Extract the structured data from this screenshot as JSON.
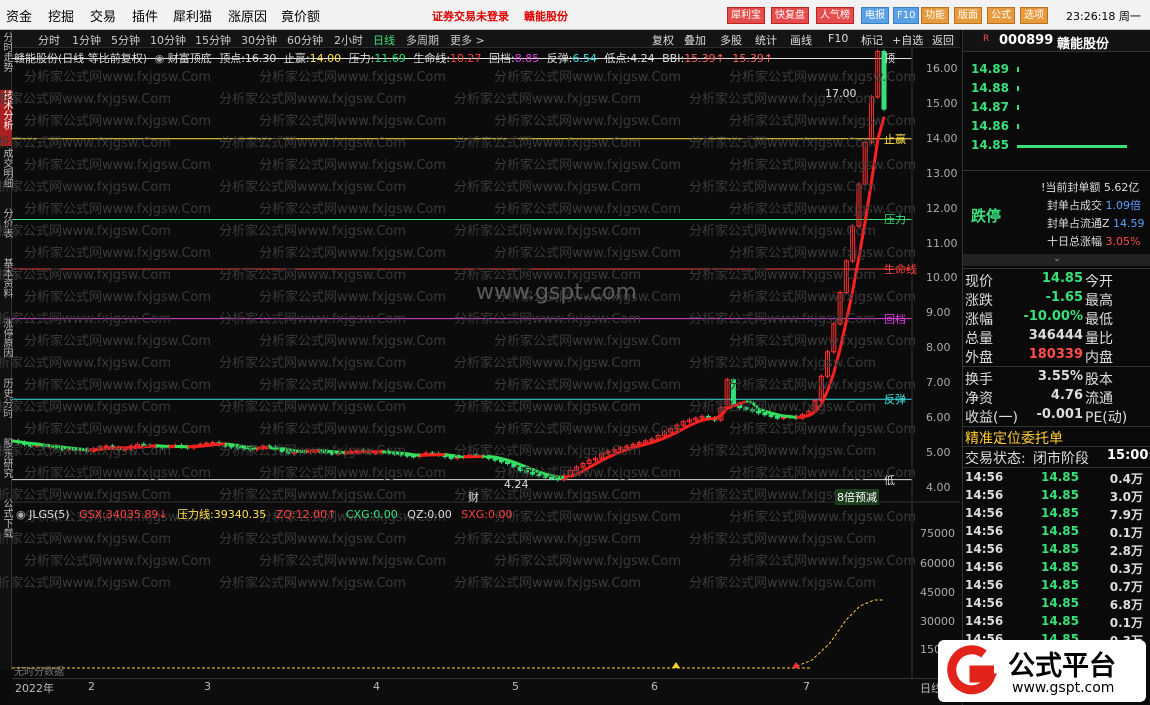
{
  "menu": [
    "资金",
    "挖掘",
    "交易",
    "插件",
    "犀利猫",
    "涨原因",
    "竟价额"
  ],
  "warning": "证券交易未登录",
  "warning_stock": "赣能股份",
  "top_buttons": [
    "犀利宝",
    "快复盘",
    "人气榜",
    "电报",
    "F10",
    "功能",
    "版面",
    "公式",
    "选项"
  ],
  "clock": "23:26:18 周一",
  "left_tabs": [
    "分时走势",
    "技术分析",
    "成交明细",
    "分价表",
    "基本资料",
    "涨停原因",
    "历史分时",
    "股东研究",
    "公式下载"
  ],
  "period_tabs": [
    "分时",
    "1分钟",
    "5分钟",
    "10分钟",
    "15分钟",
    "30分钟",
    "60分钟",
    "2小时",
    "日线",
    "多周期",
    "更多 >"
  ],
  "period_selected": "日线",
  "right_tools": [
    "复权",
    "叠加",
    "多股",
    "统计",
    "画线",
    "F10",
    "标记",
    "+自选",
    "返回"
  ],
  "indicator_header": {
    "stock": "赣能股份(日线 等比前复权)",
    "name": "财富顶底",
    "items": [
      {
        "label": "顶点:",
        "value": "16.30",
        "color": "#dddddd"
      },
      {
        "label": "止赢:",
        "value": "14.00",
        "color": "#ffe14a"
      },
      {
        "label": "压力:",
        "value": "11.69",
        "color": "#39e07a"
      },
      {
        "label": "生命线:",
        "value": "10.27",
        "color": "#ff4040"
      },
      {
        "label": "回档:",
        "value": "8.85",
        "color": "#e040e0"
      },
      {
        "label": "反弹:",
        "value": "6.54",
        "color": "#38e0e0"
      },
      {
        "label": "低点:",
        "value": "4.24",
        "color": "#dddddd"
      },
      {
        "label": "BBI:",
        "value": "15.39↑",
        "color": "#ff6060"
      },
      {
        "label": "",
        "value": "15.39↑",
        "color": "#ff6060"
      }
    ]
  },
  "levels": [
    {
      "name": "顶",
      "value": 16.3,
      "color": "#dddddd"
    },
    {
      "name": "止赢",
      "value": 14.0,
      "color": "#ffe14a"
    },
    {
      "name": "压力",
      "value": 11.69,
      "color": "#39e07a"
    },
    {
      "name": "生命线",
      "value": 10.27,
      "color": "#ff4040"
    },
    {
      "name": "回档",
      "value": 8.85,
      "color": "#e040e0"
    },
    {
      "name": "反弹",
      "value": 6.54,
      "color": "#38e0e0"
    },
    {
      "name": "低",
      "value": 4.24,
      "color": "#dddddd"
    }
  ],
  "price_axis": [
    "16.00",
    "15.00",
    "14.00",
    "13.00",
    "12.00",
    "11.00",
    "10.00",
    "9.00",
    "8.00",
    "7.00",
    "6.00",
    "5.00",
    "4.00"
  ],
  "peak_label": "17.00",
  "low_label": "4.24",
  "cai_marker": "财",
  "badge": "8倍预减",
  "indicator2": {
    "name": "JLGS(5)",
    "items": [
      {
        "label": "GSX:",
        "value": "34035.89↓",
        "color": "#ff4040"
      },
      {
        "label": "压力线:",
        "value": "39340.35",
        "color": "#ffe14a"
      },
      {
        "label": "ZQ:",
        "value": "12.00↑",
        "color": "#ff4040"
      },
      {
        "label": "CXG:",
        "value": "0.00",
        "color": "#39e07a"
      },
      {
        "label": "QZ:",
        "value": "0.00",
        "color": "#dddddd"
      },
      {
        "label": "SXG:",
        "value": "0.00",
        "color": "#ff4040"
      }
    ]
  },
  "vol_axis": [
    "75000",
    "60000",
    "45000",
    "30000",
    "15000"
  ],
  "x_axis": [
    "2022年",
    "2",
    "3",
    "4",
    "5",
    "6",
    "7"
  ],
  "x_axis_right": "日线",
  "sub_note": "无时分数据",
  "watermark": "分析家公式网www.fxjgsw.Com",
  "site_watermark": "www.gspt.com",
  "quote": {
    "code": "000899",
    "name": "赣能股份",
    "order_book": [
      "14.89",
      "14.88",
      "14.87",
      "14.86",
      "14.85"
    ],
    "seal": [
      {
        "label": "!当前封单额",
        "value": "5.62亿"
      },
      {
        "label": "封单占成交",
        "value": "1.09倍"
      },
      {
        "label": "封单占流通Z",
        "value": "14.59"
      },
      {
        "label": "十日总涨幅",
        "value": "3.05%"
      }
    ],
    "limit": "跌停",
    "stats": [
      {
        "l1": "现价",
        "v1": "14.85",
        "c1": "g",
        "l2": "今开"
      },
      {
        "l1": "涨跌",
        "v1": "-1.65",
        "c1": "g",
        "l2": "最高"
      },
      {
        "l1": "涨幅",
        "v1": "-10.00%",
        "c1": "g",
        "l2": "最低"
      },
      {
        "l1": "总量",
        "v1": "346444",
        "c1": "w",
        "l2": "量比"
      },
      {
        "l1": "外盘",
        "v1": "180339",
        "c1": "r",
        "l2": "内盘"
      }
    ],
    "stats2": [
      {
        "l1": "换手",
        "v1": "3.55%",
        "l2": "股本"
      },
      {
        "l1": "净资",
        "v1": "4.76",
        "l2": "流通"
      },
      {
        "l1": "收益(一)",
        "v1": "-0.001",
        "l2": "PE(动)"
      }
    ],
    "precise": "精准定位委托单",
    "status_label": "交易状态:",
    "status_value": "闭市阶段",
    "status_time": "15:00:",
    "ticks": [
      {
        "t": "14:56",
        "p": "14.85",
        "v": "0.4万"
      },
      {
        "t": "14:56",
        "p": "14.85",
        "v": "3.0万"
      },
      {
        "t": "14:56",
        "p": "14.85",
        "v": "7.9万"
      },
      {
        "t": "14:56",
        "p": "14.85",
        "v": "0.1万"
      },
      {
        "t": "14:56",
        "p": "14.85",
        "v": "2.8万"
      },
      {
        "t": "14:56",
        "p": "14.85",
        "v": "0.3万"
      },
      {
        "t": "14:56",
        "p": "14.85",
        "v": "0.7万"
      },
      {
        "t": "14:56",
        "p": "14.85",
        "v": "6.8万"
      },
      {
        "t": "14:56",
        "p": "14.85",
        "v": "0.1万"
      },
      {
        "t": "14:56",
        "p": "14.85",
        "v": "0.3万"
      }
    ]
  },
  "logo_text": "公式平台",
  "logo_url": "www.gspt.com",
  "chart_data": {
    "type": "candlestick",
    "price_range": [
      4.0,
      16.6
    ],
    "closes": [
      5.35,
      5.3,
      5.25,
      5.2,
      5.22,
      5.18,
      5.2,
      5.15,
      5.1,
      5.12,
      5.08,
      5.1,
      5.05,
      5.12,
      5.18,
      5.2,
      5.15,
      5.1,
      5.12,
      5.2,
      5.25,
      5.22,
      5.2,
      5.18,
      5.15,
      5.2,
      5.22,
      5.18,
      5.15,
      5.2,
      5.25,
      5.28,
      5.3,
      5.25,
      5.2,
      5.18,
      5.15,
      5.12,
      5.1,
      5.15,
      5.2,
      5.18,
      5.1,
      5.05,
      5.0,
      5.02,
      5.05,
      5.08,
      5.1,
      5.05,
      5.0,
      4.98,
      5.0,
      5.02,
      5.05,
      5.08,
      5.05,
      5.0,
      5.02,
      5.05,
      5.0,
      4.98,
      4.95,
      4.92,
      4.9,
      4.95,
      5.0,
      4.98,
      4.95,
      4.9,
      4.85,
      4.88,
      4.9,
      4.95,
      4.92,
      4.9,
      4.85,
      4.8,
      4.75,
      4.7,
      4.6,
      4.5,
      4.45,
      4.4,
      4.35,
      4.3,
      4.28,
      4.24,
      4.35,
      4.5,
      4.6,
      4.7,
      4.8,
      4.85,
      5.0,
      5.05,
      5.1,
      5.15,
      5.2,
      5.25,
      5.3,
      5.35,
      5.4,
      5.5,
      5.6,
      5.7,
      5.8,
      5.9,
      5.95,
      6.0,
      6.05,
      6.0,
      5.95,
      6.3,
      7.1,
      6.4,
      6.3,
      6.25,
      6.2,
      6.15,
      6.1,
      6.05,
      6.0,
      6.02,
      6.05,
      6.0,
      6.1,
      6.2,
      6.5,
      7.2,
      7.9,
      8.7,
      9.6,
      10.5,
      11.5,
      12.7,
      13.9,
      15.2,
      16.5,
      14.85
    ]
  }
}
